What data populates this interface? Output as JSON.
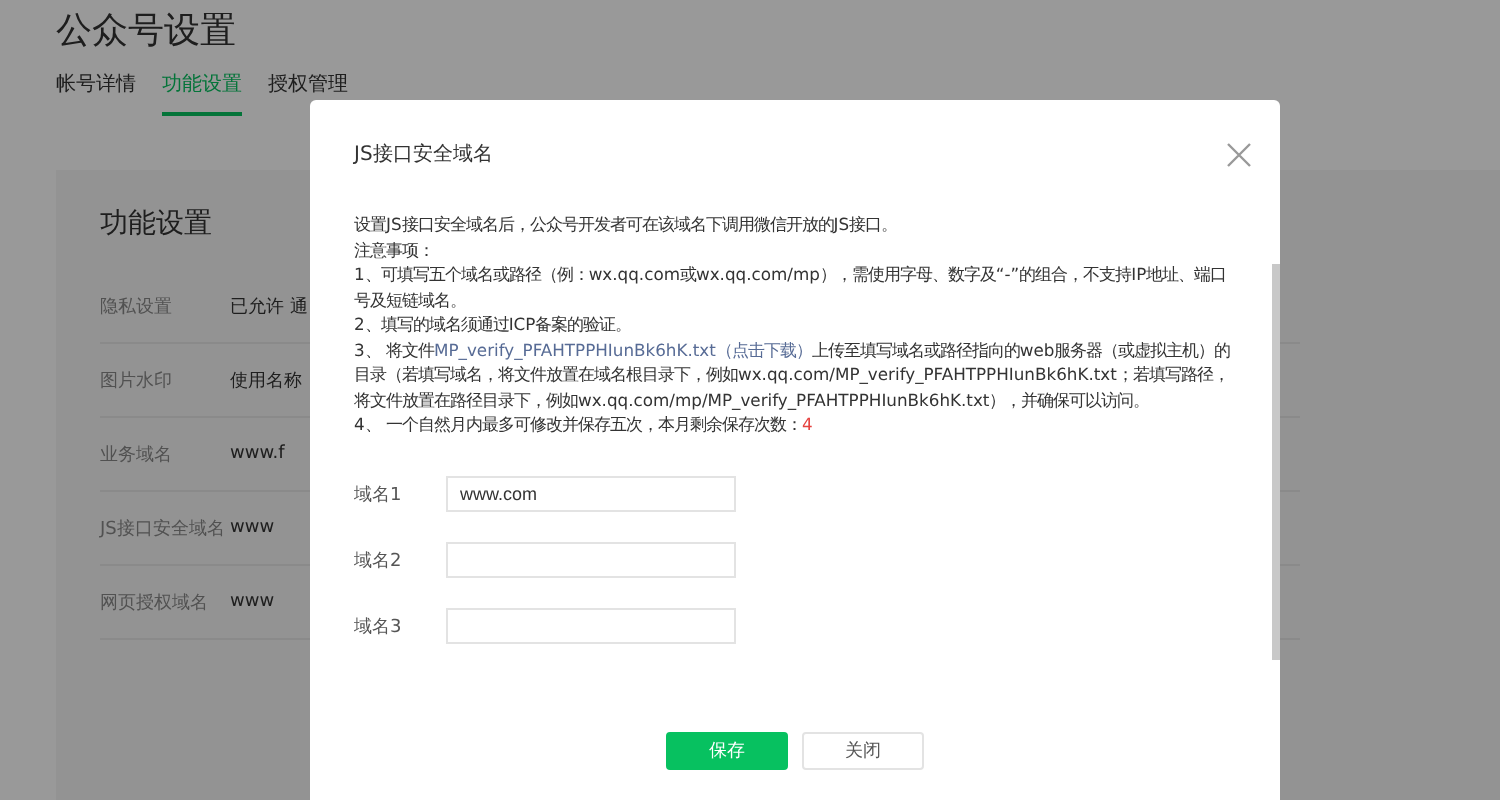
{
  "page": {
    "title": "公众号设置",
    "tabs": [
      {
        "label": "帐号详情",
        "selected": false
      },
      {
        "label": "功能设置",
        "selected": true
      },
      {
        "label": "授权管理",
        "selected": false
      }
    ],
    "card": {
      "title": "功能设置",
      "rows": [
        {
          "label": "隐私设置",
          "value": "已允许 通"
        },
        {
          "label": "图片水印",
          "value": "使用名称"
        },
        {
          "label": "业务域名",
          "value": "www.f"
        },
        {
          "label": "JS接口安全域名",
          "value": "www"
        },
        {
          "label": "网页授权域名",
          "value": "www"
        }
      ]
    }
  },
  "dialog": {
    "title": "JS接口安全域名",
    "intro": "设置JS接口安全域名后，公众号开发者可在该域名下调用微信开放的JS接口。",
    "notes_heading": "注意事项：",
    "note_1": "1、可填写五个域名或路径（例：wx.qq.com或wx.qq.com/mp），需使用字母、数字及“-”的组合，不支持IP地址、端口号及短链域名。",
    "note_2": "2、填写的域名须通过ICP备案的验证。",
    "note_3": {
      "before": "3、 将文件",
      "link": "MP_verify_PFAHTPPHIunBk6hK.txt（点击下载）",
      "after": "上传至填写域名或路径指向的web服务器（或虚拟主机）的目录（若填写域名，将文件放置在域名根目录下，例如wx.qq.com/MP_verify_PFAHTPPHIunBk6hK.txt；若填写路径，将文件放置在路径目录下，例如wx.qq.com/mp/MP_verify_PFAHTPPHIunBk6hK.txt），并确保可以访问。"
    },
    "note_4": {
      "text": "4、 一个自然月内最多可修改并保存五次，本月剩余保存次数：",
      "count": "4"
    },
    "fields": [
      {
        "label": "域名1",
        "value": "www.com"
      },
      {
        "label": "域名2"
      },
      {
        "label": "域名3"
      }
    ],
    "buttons": [
      {
        "label": "保存",
        "kind": "primary"
      },
      {
        "label": "关闭",
        "kind": "default"
      }
    ]
  }
}
